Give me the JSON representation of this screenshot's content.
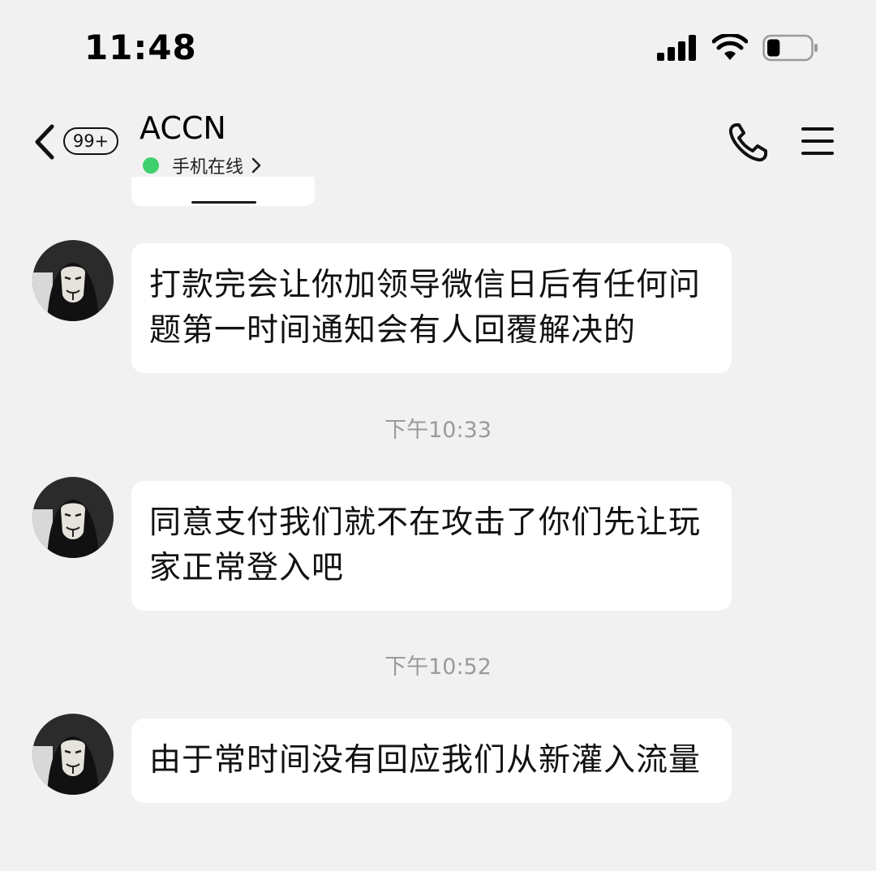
{
  "status_bar": {
    "time": "11:48",
    "battery_level": 0.3
  },
  "header": {
    "unread_badge": "99+",
    "contact_name": "ACCN",
    "presence": "手机在线",
    "presence_color": "#3fd06e",
    "icons": [
      "back-chevron-icon",
      "phone-icon",
      "menu-icon"
    ]
  },
  "messages": [
    {
      "text": "打款完会让你加领导微信日后有任何问题第一时间通知会有人回覆解决的"
    },
    {
      "timestamp": "下午10:33",
      "text": "同意支付我们就不在攻击了你们先让玩家正常登入吧"
    },
    {
      "timestamp": "下午10:52",
      "text": "由于常时间没有回应我们从新灌入流量"
    }
  ]
}
